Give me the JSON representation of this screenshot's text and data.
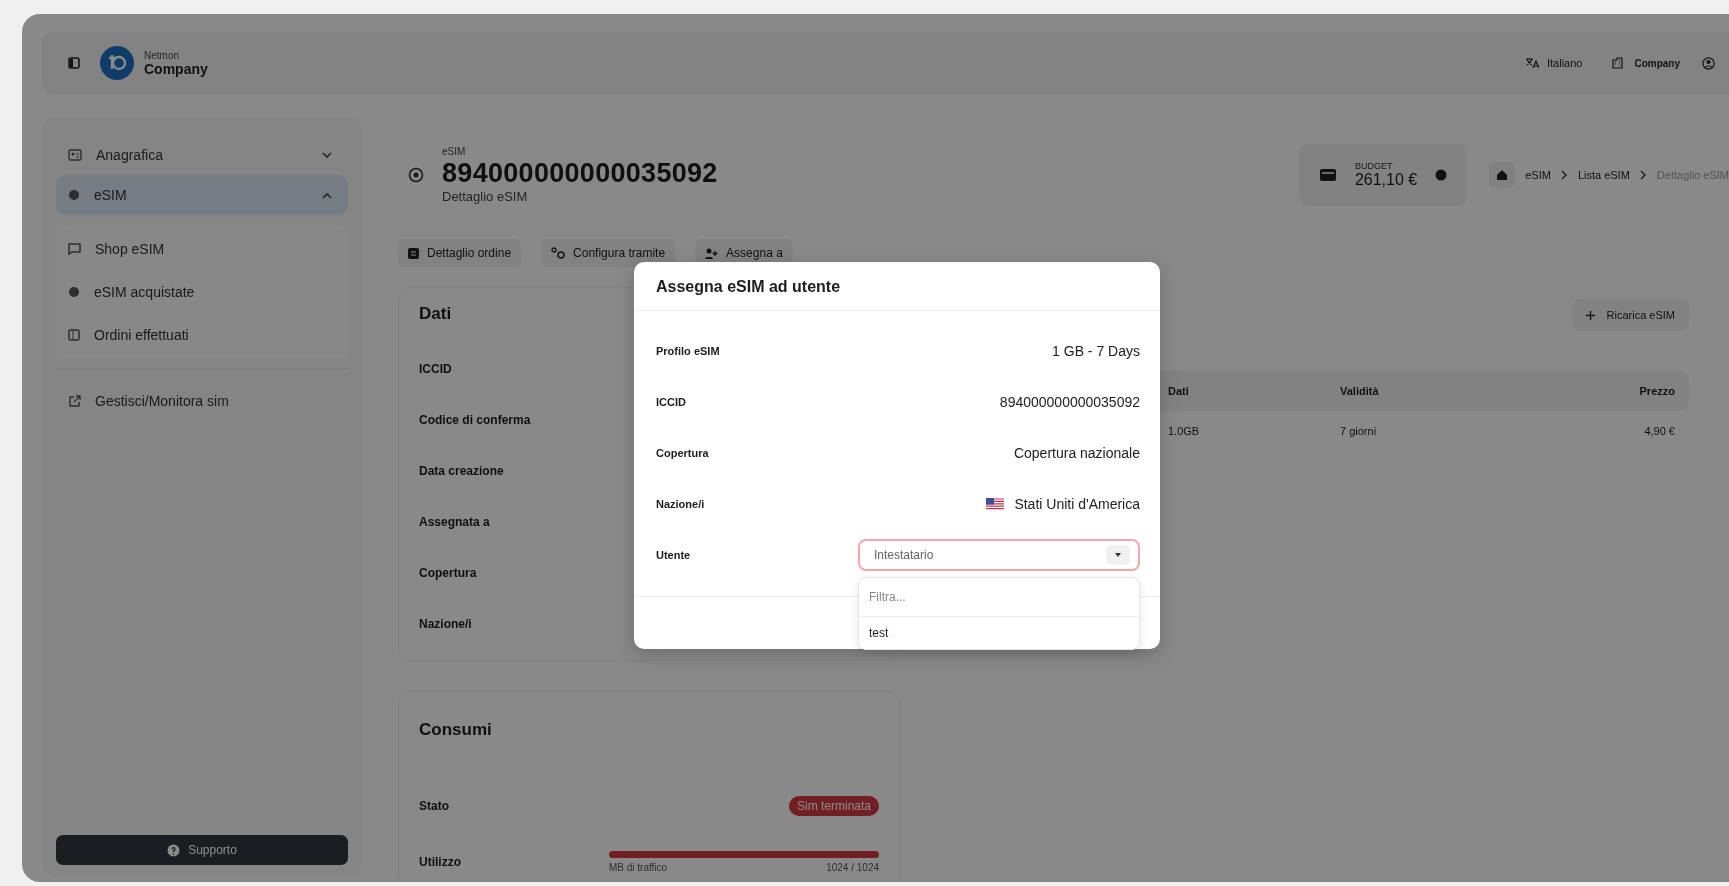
{
  "topbar": {
    "brand_small": "Netmon",
    "brand": "Company",
    "language": "Italiano",
    "account": "Company"
  },
  "sidebar": {
    "items": [
      {
        "label": "Anagrafica",
        "kind": "group",
        "expanded": false,
        "selected": false
      },
      {
        "label": "eSIM",
        "kind": "group",
        "expanded": true,
        "selected": true,
        "children": [
          {
            "label": "Shop eSIM"
          },
          {
            "label": "eSIM acquistate"
          },
          {
            "label": "Ordini effettuati"
          }
        ]
      },
      {
        "label": "Gestisci/Monitora sim",
        "kind": "link",
        "selected": false
      }
    ],
    "support": "Supporto"
  },
  "header": {
    "overline": "eSIM",
    "title": "894000000000035092",
    "subtitle": "Dettaglio eSIM"
  },
  "budget": {
    "label": "BUDGET",
    "amount": "261,10 €"
  },
  "breadcrumb": [
    "eSIM",
    "Lista eSIM",
    "Dettaglio eSIM"
  ],
  "actions": [
    "Dettaglio ordine",
    "Configura tramite",
    "Assegna a"
  ],
  "dati": {
    "title": "Dati",
    "labels": [
      "ICCID",
      "Codice di conferma",
      "Data creazione",
      "Assegnata a",
      "Copertura",
      "Nazione/i"
    ]
  },
  "consumi": {
    "title": "Consumi",
    "rows": [
      {
        "label": "Stato",
        "kind": "badge",
        "badge": "Sim terminata"
      },
      {
        "label": "Utilizzo",
        "kind": "usage",
        "level": 1,
        "caption": "MB di traffico",
        "reading": "1024 / 1024"
      }
    ]
  },
  "recharge_button": "Ricarica eSIM",
  "plans": {
    "columns": [
      "Dati",
      "Validità",
      "Prezzo"
    ],
    "rows": [
      [
        "1.0GB",
        "7 giorni",
        "4,90 €"
      ]
    ]
  },
  "modal": {
    "title": "Assegna eSIM ad utente",
    "fields": [
      {
        "label": "Profilo eSIM",
        "kind": "text",
        "value": "1 GB - 7 Days"
      },
      {
        "label": "ICCID",
        "kind": "text",
        "value": "894000000000035092"
      },
      {
        "label": "Copertura",
        "kind": "text",
        "value": "Copertura nazionale"
      },
      {
        "label": "Nazione/i",
        "kind": "country",
        "value": "Stati Uniti d'America"
      },
      {
        "label": "Utente",
        "kind": "select",
        "placeholder": "Intestatario",
        "invalid": true,
        "open": true,
        "filter_placeholder": "Filtra...",
        "options": [
          {
            "label": "test",
            "selected": false
          }
        ]
      }
    ]
  }
}
